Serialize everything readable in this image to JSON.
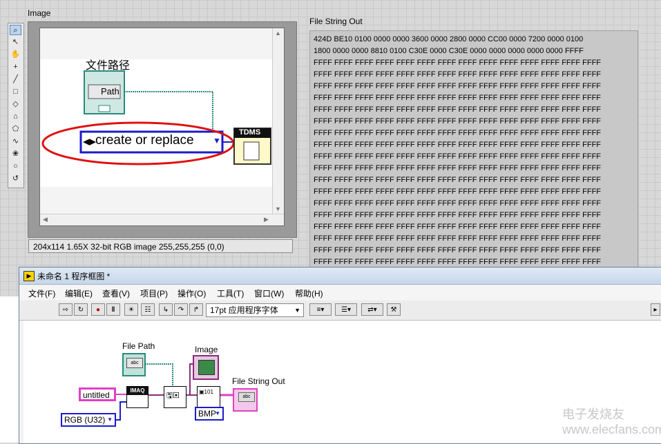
{
  "front_panel": {
    "image_label": "Image",
    "file_string_out_label": "File String Out",
    "status_bar": "204x114 1.65X 32-bit RGB image 255,255,255     (0,0)",
    "image_content": {
      "path_caption": "文件路径",
      "path_box": "Path",
      "ring_text": "create or replace",
      "tdms_label": "TDMS"
    },
    "file_string_lines": [
      "424D BE10 0100 0000 0000 3600 0000 2800 0000 CC00 0000 7200 0000 0100",
      "1800 0000 0000 8810 0100 C30E 0000 C30E 0000 0000 0000 0000 0000 FFFF",
      "FFFF FFFF FFFF FFFF FFFF FFFF FFFF FFFF FFFF FFFF FFFF FFFF FFFF FFFF",
      "FFFF FFFF FFFF FFFF FFFF FFFF FFFF FFFF FFFF FFFF FFFF FFFF FFFF FFFF",
      "FFFF FFFF FFFF FFFF FFFF FFFF FFFF FFFF FFFF FFFF FFFF FFFF FFFF FFFF",
      "FFFF FFFF FFFF FFFF FFFF FFFF FFFF FFFF FFFF FFFF FFFF FFFF FFFF FFFF",
      "FFFF FFFF FFFF FFFF FFFF FFFF FFFF FFFF FFFF FFFF FFFF FFFF FFFF FFFF",
      "FFFF FFFF FFFF FFFF FFFF FFFF FFFF FFFF FFFF FFFF FFFF FFFF FFFF FFFF",
      "FFFF FFFF FFFF FFFF FFFF FFFF FFFF FFFF FFFF FFFF FFFF FFFF FFFF FFFF",
      "FFFF FFFF FFFF FFFF FFFF FFFF FFFF FFFF FFFF FFFF FFFF FFFF FFFF FFFF",
      "FFFF FFFF FFFF FFFF FFFF FFFF FFFF FFFF FFFF FFFF FFFF FFFF FFFF FFFF",
      "FFFF FFFF FFFF FFFF FFFF FFFF FFFF FFFF FFFF FFFF FFFF FFFF FFFF FFFF",
      "FFFF FFFF FFFF FFFF FFFF FFFF FFFF FFFF FFFF FFFF FFFF FFFF FFFF FFFF",
      "FFFF FFFF FFFF FFFF FFFF FFFF FFFF FFFF FFFF FFFF FFFF FFFF FFFF FFFF",
      "FFFF FFFF FFFF FFFF FFFF FFFF FFFF FFFF FFFF FFFF FFFF FFFF FFFF FFFF",
      "FFFF FFFF FFFF FFFF FFFF FFFF FFFF FFFF FFFF FFFF FFFF FFFF FFFF FFFF",
      "FFFF FFFF FFFF FFFF FFFF FFFF FFFF FFFF FFFF FFFF FFFF FFFF FFFF FFFF",
      "FFFF FFFF FFFF FFFF FFFF FFFF FFFF FFFF FFFF FFFF FFFF FFFF FFFF FFFF",
      "FFFF FFFF FFFF FFFF FFFF FFFF FFFF FFFF FFFF FFFF FFFF FFFF FFFF FFFF",
      "FFFF FFFF FFFF FFFF FFFF FFFF FFFF FFFF FFFF FFFF FFFF FFFF FFFF FFFF"
    ]
  },
  "block_diagram_window": {
    "title": "未命名 1 程序框图 *",
    "menus": [
      "文件(F)",
      "编辑(E)",
      "查看(V)",
      "项目(P)",
      "操作(O)",
      "工具(T)",
      "窗口(W)",
      "帮助(H)"
    ],
    "font_select": "17pt 应用程序字体",
    "nodes": {
      "file_path_label": "File Path",
      "image_label": "Image",
      "file_string_out_label": "File String Out",
      "untitled_const": "untitled",
      "imaq_label": "IMAQ",
      "rgb_const": "RGB (U32)",
      "bmp_const": "BMP",
      "abc": "abc"
    }
  },
  "watermark": "电子发烧友\nwww.elecfans.com",
  "colors": {
    "path_wire": "#2a8a7a",
    "image_wire": "#8a2a7a",
    "string_wire": "#e040c0",
    "enum_blue": "#1a1acc",
    "annotation_red": "#e01010"
  }
}
